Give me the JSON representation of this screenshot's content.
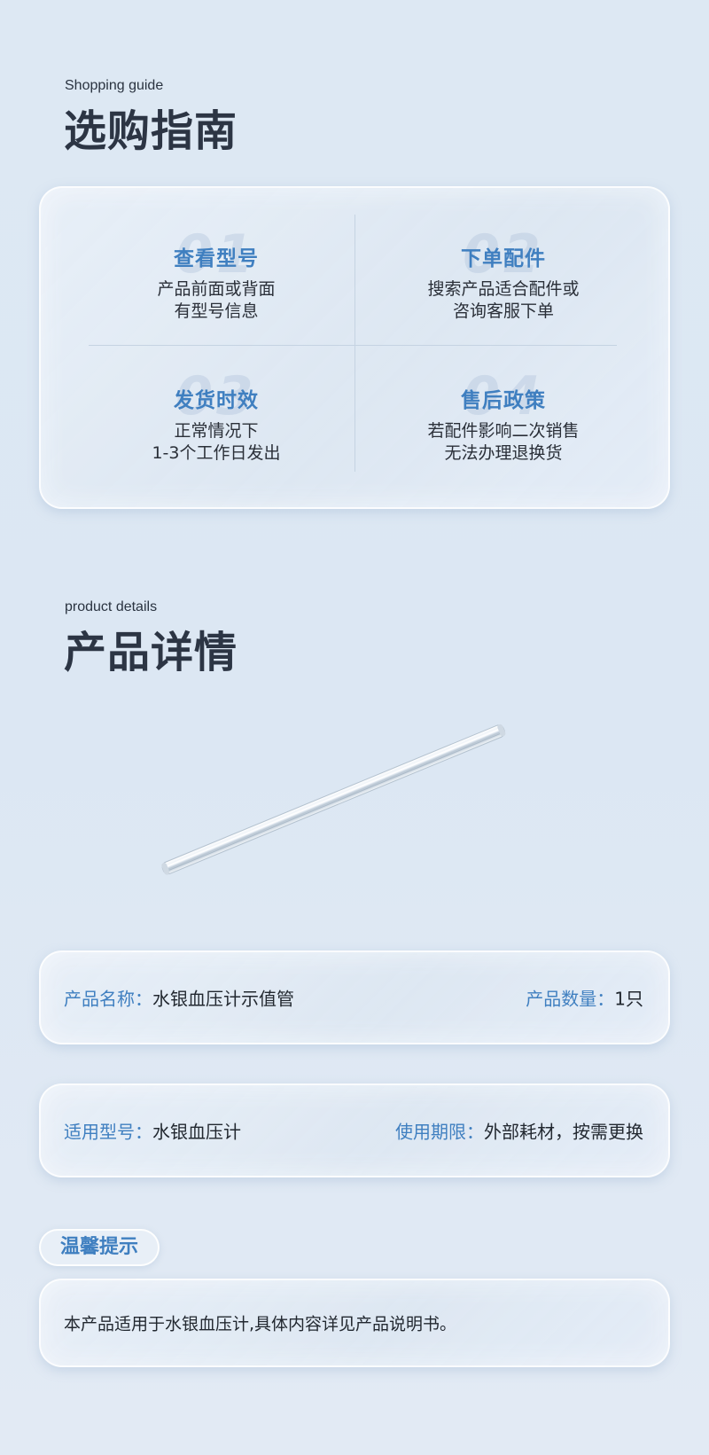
{
  "guide": {
    "eyebrow": "Shopping guide",
    "title": "选购指南",
    "items": [
      {
        "num": "01",
        "title": "查看型号",
        "desc": "产品前面或背面\n有型号信息"
      },
      {
        "num": "02",
        "title": "下单配件",
        "desc": "搜索产品适合配件或\n咨询客服下单"
      },
      {
        "num": "03",
        "title": "发货时效",
        "desc": "正常情况下\n1-3个工作日发出"
      },
      {
        "num": "04",
        "title": "售后政策",
        "desc": "若配件影响二次销售\n无法办理退换货"
      }
    ]
  },
  "details": {
    "eyebrow": "product details",
    "title": "产品详情",
    "product_image": "glass-tube",
    "rows": [
      {
        "left_label": "产品名称：",
        "left_value": "水银血压计示值管",
        "right_label": "产品数量：",
        "right_value": "1只"
      },
      {
        "left_label": "适用型号：",
        "left_value": "水银血压计",
        "right_label": "使用期限：",
        "right_value": "外部耗材，按需更换"
      }
    ]
  },
  "tips": {
    "label": "温馨提示",
    "text": "本产品适用于水银血压计,具体内容详见产品说明书。"
  },
  "colors": {
    "accent": "#3f7fc0",
    "title": "#2c3544",
    "background": "#dde8f3"
  }
}
